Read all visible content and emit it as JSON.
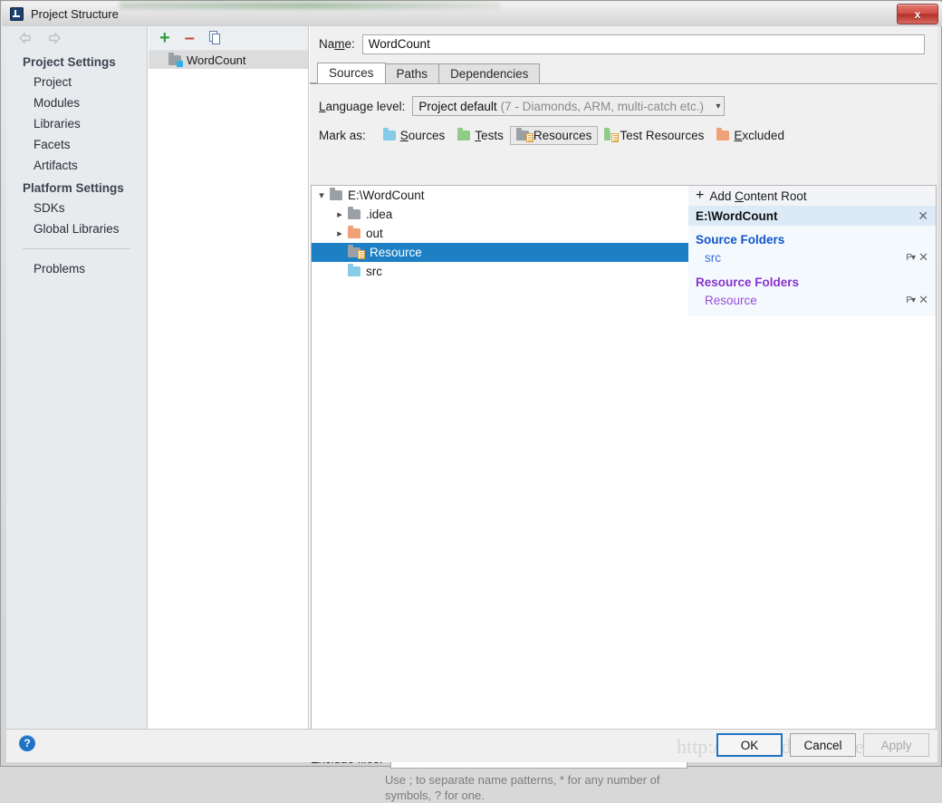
{
  "window": {
    "title": "Project Structure",
    "app_icon": "intellij-idea-icon",
    "close_label": "x"
  },
  "sidebar": {
    "back_icon": "arrow-left-icon",
    "forward_icon": "arrow-right-icon",
    "groups": [
      {
        "title": "Project Settings",
        "items": [
          "Project",
          "Modules",
          "Libraries",
          "Facets",
          "Artifacts"
        ]
      },
      {
        "title": "Platform Settings",
        "items": [
          "SDKs",
          "Global Libraries"
        ]
      }
    ],
    "problems": "Problems"
  },
  "modules": {
    "toolbar": {
      "add": "+",
      "remove": "–",
      "copy": "copy-icon"
    },
    "items": [
      {
        "label": "WordCount",
        "icon": "module-folder-icon",
        "selected": true
      }
    ]
  },
  "main": {
    "name_label": "Name:",
    "name_value": "WordCount",
    "tabs": [
      {
        "label": "Sources",
        "active": true
      },
      {
        "label": "Paths",
        "active": false
      },
      {
        "label": "Dependencies",
        "active": false
      }
    ],
    "language_level": {
      "label": "Language level:",
      "value": "Project default",
      "detail": "(7 - Diamonds, ARM, multi-catch etc.)",
      "chevron": "chevron-down-icon"
    },
    "mark_as": {
      "label": "Mark as:",
      "options": [
        {
          "label": "Sources",
          "icon": "folder-sources-icon",
          "selected": false
        },
        {
          "label": "Tests",
          "icon": "folder-tests-icon",
          "selected": false
        },
        {
          "label": "Resources",
          "icon": "folder-resources-icon",
          "selected": true
        },
        {
          "label": "Test Resources",
          "icon": "folder-test-resources-icon",
          "selected": false
        },
        {
          "label": "Excluded",
          "icon": "folder-excluded-icon",
          "selected": false
        }
      ]
    },
    "tree": [
      {
        "label": "E:\\WordCount",
        "twisty": "expanded",
        "indent": 0,
        "icon": "folder-gray-icon",
        "selected": false
      },
      {
        "label": ".idea",
        "twisty": "collapsed",
        "indent": 1,
        "icon": "folder-gray-icon",
        "selected": false
      },
      {
        "label": "out",
        "twisty": "collapsed",
        "indent": 1,
        "icon": "folder-excluded-icon",
        "selected": false
      },
      {
        "label": "Resource",
        "twisty": "none",
        "indent": 1,
        "icon": "folder-resources-icon",
        "selected": true
      },
      {
        "label": "src",
        "twisty": "none",
        "indent": 1,
        "icon": "folder-sources-icon",
        "selected": false
      }
    ],
    "content_roots": {
      "add_label": "Add Content Root",
      "add_icon": "plus-icon",
      "root_path": "E:\\WordCount",
      "remove_icon": "close-icon",
      "groups": [
        {
          "title": "Source Folders",
          "kind": "source",
          "rows": [
            {
              "label": "src",
              "prefix_icon": "package-prefix-icon",
              "remove_icon": "close-icon"
            }
          ]
        },
        {
          "title": "Resource Folders",
          "kind": "resource",
          "rows": [
            {
              "label": "Resource",
              "prefix_icon": "package-prefix-icon",
              "remove_icon": "close-icon"
            }
          ]
        }
      ]
    },
    "exclude": {
      "label": "Exclude files:",
      "value": "",
      "hint": "Use ; to separate name patterns, * for any number of symbols, ? for one."
    }
  },
  "footer": {
    "help_icon": "help-icon",
    "watermark": "http://blog.csdn.net/agent_x",
    "buttons": [
      {
        "label": "OK",
        "style": "primary"
      },
      {
        "label": "Cancel",
        "style": "normal"
      },
      {
        "label": "Apply",
        "style": "disabled"
      }
    ]
  },
  "colors": {
    "selection_blue": "#1d7fc4",
    "source_blue": "#1155cc",
    "resource_purple": "#8833cc",
    "accent_border": "#1f73c4"
  }
}
